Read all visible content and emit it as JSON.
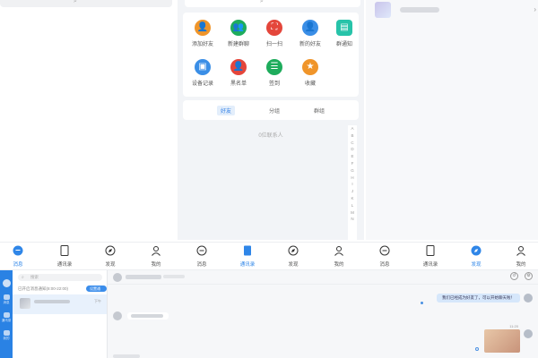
{
  "top": {
    "search_icon": "search-icon",
    "func_items": [
      {
        "label": "添加好友",
        "icon": "add-friend-icon",
        "color": "#f0952a"
      },
      {
        "label": "新建群聊",
        "icon": "new-group-icon",
        "color": "#1eac5c"
      },
      {
        "label": "扫一扫",
        "icon": "scan-icon",
        "color": "#e4463b"
      },
      {
        "label": "新的好友",
        "icon": "new-friends-icon",
        "color": "#3a8ee6"
      },
      {
        "label": "群通知",
        "icon": "group-notice-icon",
        "color": "#27c3a9"
      },
      {
        "label": "设备记录",
        "icon": "device-record-icon",
        "color": "#3a8ee6"
      },
      {
        "label": "黑名单",
        "icon": "blacklist-icon",
        "color": "#e4463b"
      },
      {
        "label": "签到",
        "icon": "checkin-icon",
        "color": "#1eac5c"
      },
      {
        "label": "收藏",
        "icon": "favorites-icon",
        "color": "#f0952a"
      }
    ],
    "tabs": [
      "好友",
      "分组",
      "群组"
    ],
    "active_tab": "好友",
    "empty_tip": "0位联系人",
    "alphabet": [
      "A",
      "B",
      "C",
      "D",
      "E",
      "F",
      "G",
      "H",
      "I",
      "J",
      "K",
      "L",
      "M",
      "N"
    ]
  },
  "tabbar": {
    "groups": [
      {
        "items": [
          {
            "label": "消息",
            "icon": "chat-bubble-icon"
          },
          {
            "label": "通讯录",
            "icon": "contacts-icon"
          },
          {
            "label": "发现",
            "icon": "compass-icon"
          },
          {
            "label": "我的",
            "icon": "person-icon"
          }
        ],
        "active": 0
      },
      {
        "items": [
          {
            "label": "消息",
            "icon": "chat-bubble-icon"
          },
          {
            "label": "通讯录",
            "icon": "contacts-icon"
          },
          {
            "label": "发现",
            "icon": "compass-icon"
          },
          {
            "label": "我的",
            "icon": "person-icon"
          }
        ],
        "active": 1
      },
      {
        "items": [
          {
            "label": "消息",
            "icon": "chat-bubble-icon"
          },
          {
            "label": "通讯录",
            "icon": "contacts-icon"
          },
          {
            "label": "发现",
            "icon": "compass-icon"
          },
          {
            "label": "我的",
            "icon": "person-icon"
          }
        ],
        "active": 2
      }
    ],
    "active_color": "#2f86e8"
  },
  "pc": {
    "sidebar_labels": [
      "消息",
      "通讯录",
      "我的"
    ],
    "search_placeholder": "搜索",
    "notice_text": "已开启消息通知(8:00-22:00)",
    "notice_button": "设置通知",
    "conv_time": "下午",
    "bubble_right": "我们已经成为好友了，可以开始聊天啦！",
    "photo_tag": "11:20"
  }
}
